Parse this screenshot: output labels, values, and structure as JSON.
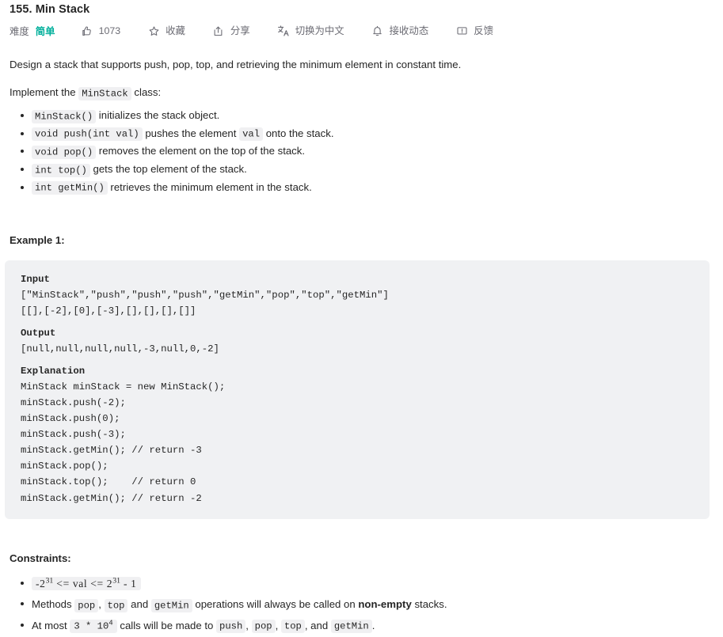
{
  "header": {
    "title": "155. Min Stack",
    "difficulty_label": "难度",
    "difficulty_value": "简单",
    "difficulty_color": "#00af9b",
    "actions": [
      {
        "icon": "thumbs-up-icon",
        "label": "1073"
      },
      {
        "icon": "star-icon",
        "label": "收藏"
      },
      {
        "icon": "share-icon",
        "label": "分享"
      },
      {
        "icon": "translate-icon",
        "label": "切换为中文"
      },
      {
        "icon": "bell-icon",
        "label": "接收动态"
      },
      {
        "icon": "feedback-icon",
        "label": "反馈"
      }
    ]
  },
  "description": {
    "intro": "Design a stack that supports push, pop, top, and retrieving the minimum element in constant time.",
    "implement_prefix": "Implement the ",
    "implement_code": "MinStack",
    "implement_suffix": " class:",
    "methods": [
      {
        "code": "MinStack()",
        "text_after": " initializes the stack object."
      },
      {
        "code": "void push(int val)",
        "text_after": " pushes the element ",
        "code2": "val",
        "text_after2": " onto the stack."
      },
      {
        "code": "void pop()",
        "text_after": " removes the element on the top of the stack."
      },
      {
        "code": "int top()",
        "text_after": " gets the top element of the stack."
      },
      {
        "code": "int getMin()",
        "text_after": " retrieves the minimum element in the stack."
      }
    ]
  },
  "example": {
    "heading": "Example 1:",
    "input_label": "Input",
    "input_lines": "[\"MinStack\",\"push\",\"push\",\"push\",\"getMin\",\"pop\",\"top\",\"getMin\"]\n[[],[-2],[0],[-3],[],[],[],[]]",
    "output_label": "Output",
    "output_lines": "[null,null,null,null,-3,null,0,-2]",
    "explanation_label": "Explanation",
    "explanation_lines": "MinStack minStack = new MinStack();\nminStack.push(-2);\nminStack.push(0);\nminStack.push(-3);\nminStack.getMin(); // return -3\nminStack.pop();\nminStack.top();    // return 0\nminStack.getMin(); // return -2"
  },
  "constraints": {
    "heading": "Constraints:",
    "items": [
      {
        "type": "math",
        "math_pre": "-2",
        "math_sup1": "31",
        "math_mid": " <= val <= 2",
        "math_sup2": "31",
        "math_post": " - 1"
      },
      {
        "type": "text",
        "seg1": "Methods ",
        "code1": "pop",
        "seg2": ", ",
        "code2": "top",
        "seg3": " and ",
        "code3": "getMin",
        "seg4": " operations will always be called on ",
        "bold": "non-empty",
        "seg5": " stacks."
      },
      {
        "type": "calls",
        "seg1": "At most ",
        "math_pre": "3 * 10",
        "math_sup": "4",
        "seg2": " calls will be made to ",
        "code1": "push",
        "seg3": ", ",
        "code2": "pop",
        "seg4": ", ",
        "code3": "top",
        "seg5": ", and ",
        "code4": "getMin",
        "seg6": "."
      }
    ]
  }
}
